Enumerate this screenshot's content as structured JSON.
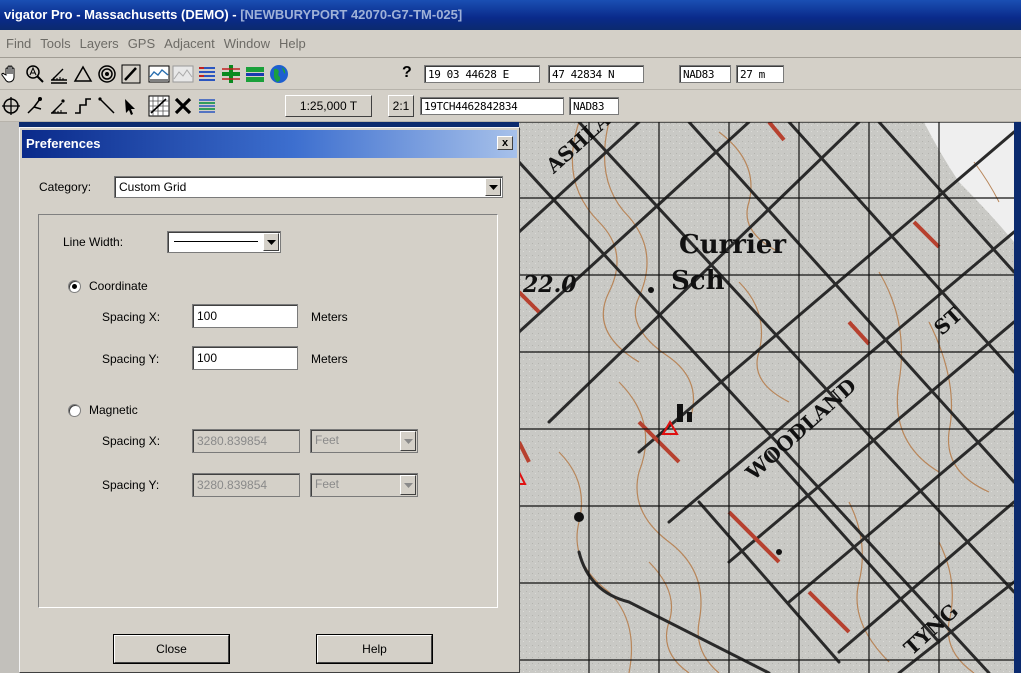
{
  "window": {
    "title_main": "vigator Pro - Massachusetts (DEMO) - ",
    "title_doc": "[NEWBURYPORT 42070-G7-TM-025]"
  },
  "menu": [
    "Find",
    "Tools",
    "Layers",
    "GPS",
    "Adjacent",
    "Window",
    "Help"
  ],
  "toolbar1": {
    "icons": [
      "hand-icon",
      "zoom-icon",
      "ruler-icon",
      "waypoint-triangle-icon",
      "target-icon",
      "pencil-icon",
      "profile-icon",
      "shaded-relief-icon",
      "layer-list-icon",
      "add-grid-icon",
      "color-bars-icon",
      "globe-icon"
    ],
    "help_glyph": "?",
    "easting": "19 03 44628 E",
    "northing": "47 42834 N",
    "datum": "NAD83",
    "elevation": "27 m"
  },
  "toolbar2": {
    "icons": [
      "gps-target-icon",
      "route-tool-icon",
      "measure-icon",
      "track-icon",
      "line-tool-icon",
      "select-arrow-icon",
      "grid-toggle-icon",
      "delete-x-icon",
      "layers-stack-icon"
    ],
    "scale": "1:25,000 T",
    "ratio": "2:1",
    "mgrs": "19TCH4462842834",
    "datum2": "NAD83"
  },
  "map": {
    "labels": [
      "ASHLAND",
      "Currier",
      "Sch",
      "22.0",
      "ST",
      "WOODLAND",
      "TYNG"
    ]
  },
  "dialog": {
    "title": "Preferences",
    "close_glyph": "x",
    "category_label": "Category:",
    "category_value": "Custom Grid",
    "line_width_label": "Line Width:",
    "coordinate": {
      "label": "Coordinate",
      "selected": true,
      "spacing_x_label": "Spacing X:",
      "spacing_x_value": "100",
      "spacing_y_label": "Spacing Y:",
      "spacing_y_value": "100",
      "units": "Meters"
    },
    "magnetic": {
      "label": "Magnetic",
      "selected": false,
      "spacing_x_label": "Spacing X:",
      "spacing_x_value": "3280.839854",
      "spacing_y_label": "Spacing Y:",
      "spacing_y_value": "3280.839854",
      "units": "Feet"
    },
    "close_button": "Close",
    "help_button": "Help"
  },
  "colors": {
    "title_bar": "#0a2a8a",
    "face": "#d4d0c8",
    "map_background": "#c9c9c5",
    "road_red": "#b7412f",
    "contour": "#b8865a"
  }
}
